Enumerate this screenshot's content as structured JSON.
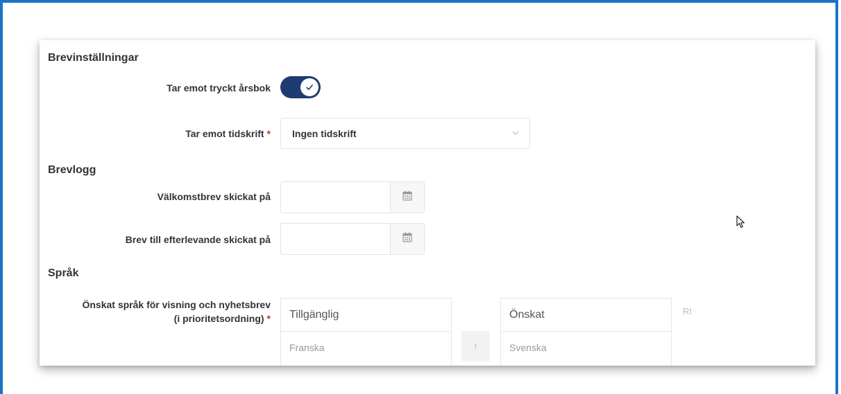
{
  "sections": {
    "letter_settings": "Brevinställningar",
    "letter_log": "Brevlogg",
    "language": "Språk"
  },
  "fields": {
    "printed_yearbook": {
      "label": "Tar emot tryckt årsbok",
      "checked": true
    },
    "magazine": {
      "label": "Tar emot tidskrift",
      "required_mark": "*",
      "value": "Ingen tidskrift"
    },
    "welcome_letter": {
      "label": "Välkomstbrev skickat på",
      "value": ""
    },
    "bereaved_letter": {
      "label": "Brev till efterlevande skickat på",
      "value": ""
    },
    "language_pref": {
      "label_line1": "Önskat språk för visning och nyhetsbrev",
      "label_line2": "(i prioritetsordning)",
      "required_mark": "*"
    }
  },
  "language_lists": {
    "available": {
      "header": "Tillgänglig",
      "items": [
        "Franska"
      ]
    },
    "chosen": {
      "header": "Önskat",
      "items": [
        "Svenska"
      ]
    },
    "move_up_symbol": "↑",
    "side_note": "RI"
  },
  "colors": {
    "frame": "#1a73c7",
    "toggle": "#1e3c72",
    "required": "#c0392b"
  }
}
